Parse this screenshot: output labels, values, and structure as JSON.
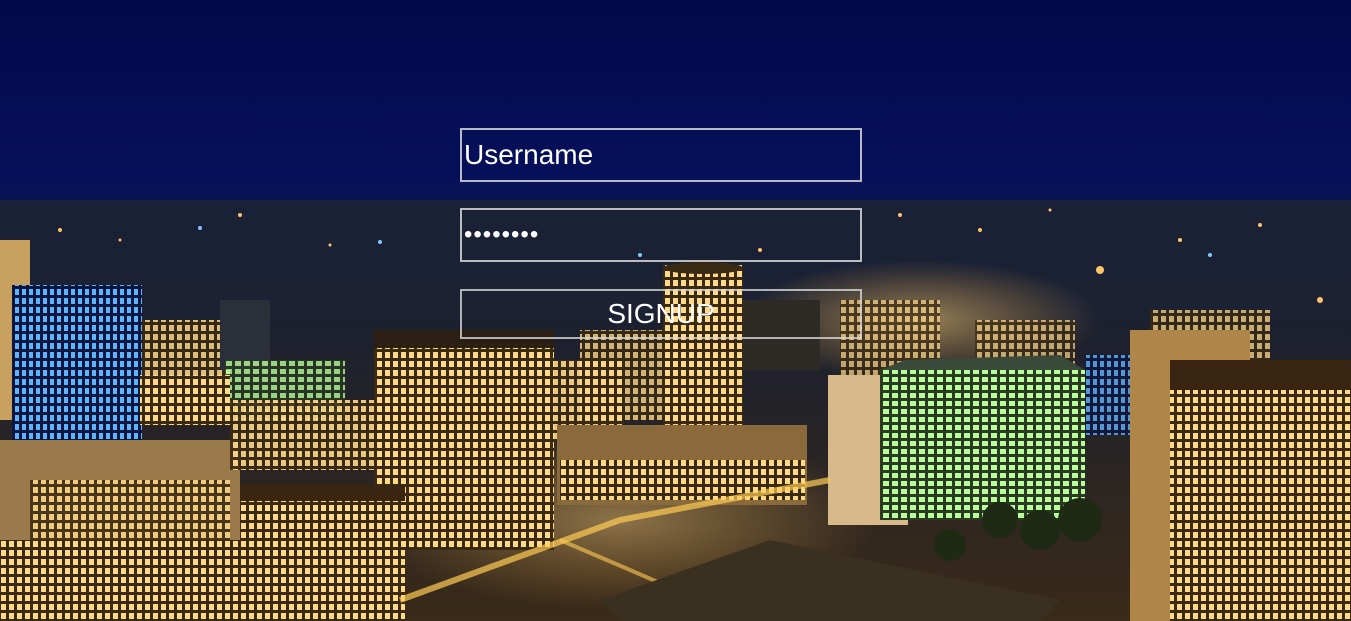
{
  "background": {
    "description_icon": "city-night-skyline-image",
    "sky_color": "#020a4a",
    "light_color": "#ffb347"
  },
  "form": {
    "username_placeholder": "Username",
    "password_value": "........",
    "signup_label": "SIGNUP"
  }
}
